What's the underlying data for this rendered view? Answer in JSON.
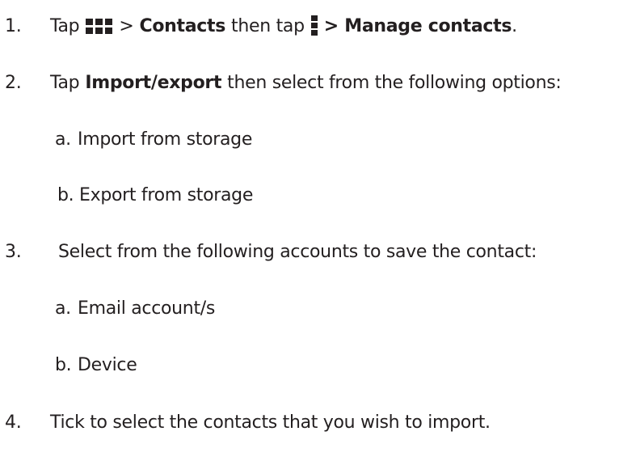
{
  "steps": [
    {
      "number": "1.",
      "parts": {
        "tap1": "Tap",
        "apps_icon": "apps-grid-icon",
        "gt1": ">",
        "contacts": "Contacts",
        "then_tap": "then tap",
        "menu_icon": "overflow-menu-icon",
        "manage": "> Manage contacts",
        "period": "."
      }
    },
    {
      "number": "2.",
      "parts": {
        "tap": "Tap",
        "import_export": "Import/export",
        "rest": "then select from the following options:"
      },
      "options": [
        {
          "letter": "a.",
          "text": "Import from storage"
        },
        {
          "letter": "b.",
          "text": "Export from storage"
        }
      ]
    },
    {
      "number": "3.",
      "text": "Select from the following accounts to save the contact:",
      "options": [
        {
          "letter": "a.",
          "text": "Email account/s"
        },
        {
          "letter": "b.",
          "text": "Device"
        }
      ]
    },
    {
      "number": "4.",
      "text": "Tick to select the contacts that you wish to import."
    }
  ]
}
